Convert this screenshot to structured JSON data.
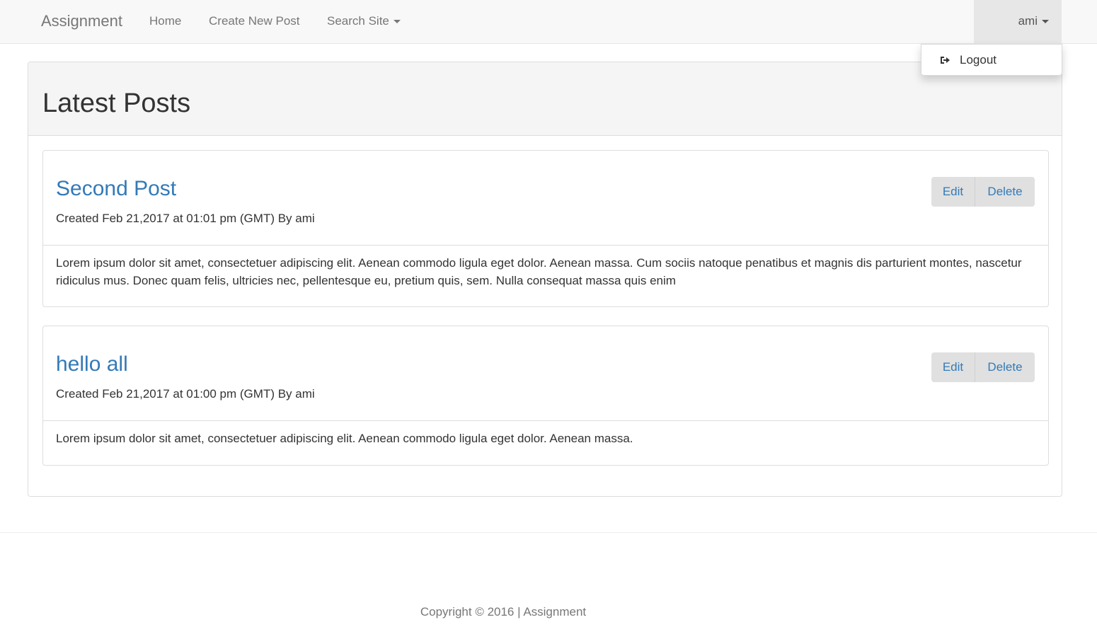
{
  "navbar": {
    "brand": "Assignment",
    "links": {
      "home": "Home",
      "create": "Create New Post",
      "search": "Search Site"
    },
    "user": "ami",
    "dropdown": {
      "logout": "Logout",
      "logout_icon": "logout-icon"
    }
  },
  "main": {
    "title": "Latest Posts",
    "posts": [
      {
        "title": "Second Post",
        "meta": "Created Feb 21,2017 at 01:01 pm (GMT) By ami",
        "edit_label": "Edit",
        "delete_label": "Delete",
        "body": "Lorem ipsum dolor sit amet, consectetuer adipiscing elit. Aenean commodo ligula eget dolor. Aenean massa. Cum sociis natoque penatibus et magnis dis parturient montes, nascetur ridiculus mus. Donec quam felis, ultricies nec, pellentesque eu, pretium quis, sem. Nulla consequat massa quis enim"
      },
      {
        "title": "hello all",
        "meta": "Created Feb 21,2017 at 01:00 pm (GMT) By ami",
        "edit_label": "Edit",
        "delete_label": "Delete",
        "body": "Lorem ipsum dolor sit amet, consectetuer adipiscing elit. Aenean commodo ligula eget dolor. Aenean massa."
      }
    ]
  },
  "footer": {
    "text": "Copyright © 2016 | Assignment"
  },
  "colors": {
    "link": "#337ab7",
    "navbar_bg": "#f8f8f8",
    "button_bg": "#e0e0e0"
  }
}
